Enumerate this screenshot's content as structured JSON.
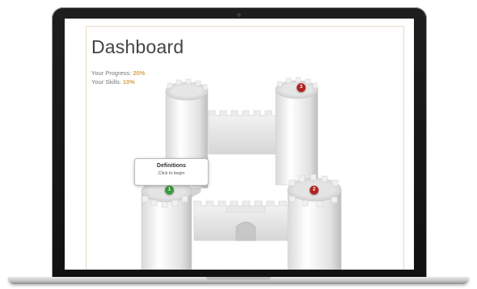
{
  "dashboard": {
    "title": "Dashboard",
    "progress_label": "Your Progress:",
    "progress_value": "20%",
    "skills_label": "Your Skills:",
    "skills_value": "10%"
  },
  "tooltip": {
    "title": "Definitions",
    "subtitle": "Click to begin"
  },
  "markers": [
    {
      "label": "1",
      "color": "#3a9a3a",
      "status": "available"
    },
    {
      "label": "2",
      "color": "#b52222",
      "status": "locked"
    },
    {
      "label": "3",
      "color": "#b52222",
      "status": "locked"
    }
  ],
  "colors": {
    "accent": "#d4a24c",
    "frame": "#151515"
  }
}
